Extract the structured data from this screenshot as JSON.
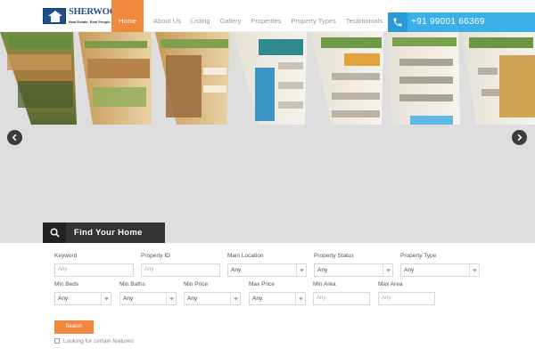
{
  "brand": {
    "name": "SHERWOOD",
    "reg": "®",
    "tagline": "Real Estate. Real People."
  },
  "nav": {
    "items": [
      "Home",
      "About Us",
      "Listing",
      "Gallery",
      "Properties",
      "Property Types",
      "Testimonials"
    ],
    "active": "Home"
  },
  "contact": {
    "phone": "+91 99001 66369"
  },
  "search": {
    "title": "Find Your Home",
    "fields": {
      "keyword": {
        "label": "Keyword",
        "placeholder": "Any"
      },
      "property_id": {
        "label": "Property ID",
        "placeholder": "Any"
      },
      "main_location": {
        "label": "Main Location",
        "value": "Any"
      },
      "property_status": {
        "label": "Property Status",
        "value": "Any"
      },
      "property_type": {
        "label": "Property Type",
        "value": "Any"
      },
      "min_beds": {
        "label": "Min Beds",
        "value": "Any"
      },
      "min_baths": {
        "label": "Min Baths",
        "value": "Any"
      },
      "min_price": {
        "label": "Min Price",
        "value": "Any"
      },
      "max_price": {
        "label": "Max Price",
        "value": "Any"
      },
      "min_area": {
        "label": "Min Area",
        "placeholder": "Any"
      },
      "max_area": {
        "label": "Max Area",
        "placeholder": "Any"
      }
    },
    "button_label": "Search",
    "features_label": "Looking for certain features"
  },
  "colors": {
    "accent": "#f0883e",
    "phone_bg": "#3bb0e8",
    "dark_tab": "#333333",
    "hero_bg": "#dedede",
    "brand_blue": "#1e4f8c"
  },
  "icons": {
    "phone": "phone-icon",
    "search": "search-icon",
    "prev": "chevron-left-icon",
    "next": "chevron-right-icon",
    "features": "plus-square-icon"
  }
}
